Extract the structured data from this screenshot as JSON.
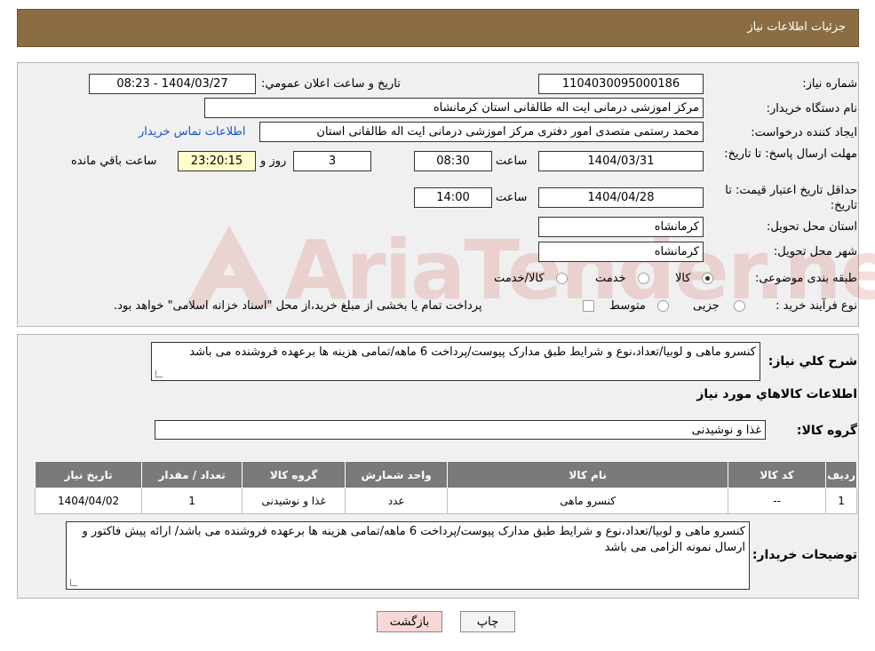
{
  "header": {
    "title": "جزئیات اطلاعات نیاز"
  },
  "labels": {
    "need_number": "شماره نیاز:",
    "announce_datetime": "تاریخ و ساعت اعلان عمومي:",
    "buyer_org": "نام دستگاه خریدار:",
    "requester": "ایجاد کننده درخواست:",
    "reply_deadline": "مهلت ارسال پاسخ: تا تاریخ:",
    "time": "ساعت",
    "day_and": "روز و",
    "remaining": "ساعت باقي مانده",
    "price_validity": "حداقل تاریخ اعتبار قیمت: تا تاریخ:",
    "delivery_province": "استان محل تحویل:",
    "delivery_city": "شهر محل تحویل:",
    "subject_category": "طبقه بندی موضوعی:",
    "purchase_type": "نوع فرآیند خرید :",
    "general_desc": "شرح کلي نیاز:",
    "goods_info": "اطلاعات کالاهاي مورد نیاز",
    "goods_group": "گروه کالا:",
    "buyer_notes": "توضیحات خریدار:"
  },
  "values": {
    "need_number": "1104030095000186",
    "announce_datetime": "1404/03/27 - 08:23",
    "buyer_org": "مرکز اموزشی درمانی ایت اله طالقانی استان کرمانشاه",
    "requester": "محمد رستمی متصدی امور دفتری مرکز اموزشی درمانی ایت اله طالقانی استان",
    "contact_link": "اطلاعات تماس خریدار",
    "reply_date": "1404/03/31",
    "reply_time": "08:30",
    "reply_days": "3",
    "reply_remaining": "23:20:15",
    "validity_date": "1404/04/28",
    "validity_time": "14:00",
    "delivery_province": "کرمانشاه",
    "delivery_city": "کرمانشاه",
    "general_desc": "کنسرو ماهی و لوبیا/تعداد،نوع و شرایط طبق مدارک پیوست/پرداخت 6 ماهه/تمامی هزینه ها برعهده فروشنده می باشد",
    "goods_group": "غذا و نوشیدنی",
    "buyer_notes": "کنسرو ماهی و لوبیا/تعداد،نوع و شرایط طبق مدارک پیوست/پرداخت 6 ماهه/تمامی هزینه ها برعهده فروشنده می باشد/ ارائه پیش فاکتور و ارسال نمونه الزامی می باشد"
  },
  "category_options": [
    "کالا",
    "خدمت",
    "کالا/خدمت"
  ],
  "purchase_options": [
    "جزیی",
    "متوسط"
  ],
  "purchase_note": "پرداخت تمام یا بخشی از مبلغ خرید،از محل \"اسناد خزانه اسلامی\" خواهد بود.",
  "table": {
    "headers": [
      "ردیف",
      "کد کالا",
      "نام کالا",
      "واحد شمارش",
      "گروه کالا",
      "تعداد / مقدار",
      "تاریخ نیاز"
    ],
    "rows": [
      [
        "1",
        "--",
        "کنسرو ماهی",
        "عدد",
        "غذا و نوشیدنی",
        "1",
        "1404/04/02"
      ]
    ]
  },
  "buttons": {
    "print": "چاپ",
    "back": "بازگشت"
  },
  "watermark": "AriaTender.neT",
  "colors": {
    "header_bg": "#8b6d43",
    "panel_bg": "#f0f0f0",
    "table_header": "#7a7a7a",
    "link": "#1a4fd6",
    "back_button": "#f8d7d7"
  }
}
